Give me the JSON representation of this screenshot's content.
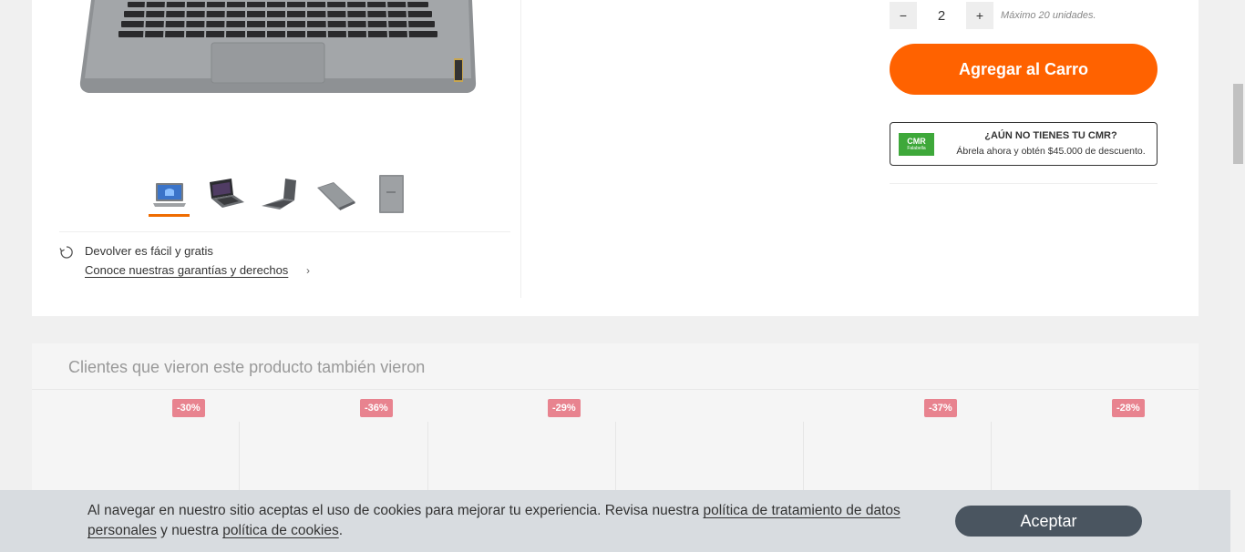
{
  "gallery": {
    "thumbnails": [
      {
        "icon": "laptop-front-icon"
      },
      {
        "icon": "laptop-angle-dark-icon"
      },
      {
        "icon": "laptop-side-icon"
      },
      {
        "icon": "laptop-closed-icon"
      },
      {
        "icon": "laptop-lid-icon"
      }
    ],
    "active_index": 0,
    "returns_title": "Devolver es fácil y gratis",
    "returns_link": "Conoce nuestras garantías y derechos"
  },
  "buy_box": {
    "minus_label": "−",
    "quantity": "2",
    "plus_label": "+",
    "max_note": "Máximo 20 unidades.",
    "add_to_cart": "Agregar al Carro",
    "cmr_logo": "CMR",
    "cmr_logo_sub": "Falabella",
    "cmr_title": "¿AÚN NO TIENES TU CMR?",
    "cmr_desc": "Ábrela ahora y obtén $45.000 de descuento."
  },
  "recommendations": {
    "title": "Clientes que vieron este producto también vieron",
    "items": [
      {
        "badge": "-30%"
      },
      {
        "badge": "-36%"
      },
      {
        "badge": "-29%"
      },
      {
        "badge": ""
      },
      {
        "badge": "-37%"
      },
      {
        "badge": "-28%"
      }
    ]
  },
  "cookie_banner": {
    "text_1": "Al navegar en nuestro sitio aceptas el uso de cookies para mejorar tu experiencia. Revisa nuestra ",
    "link_1": "política de tratamiento de datos personales",
    "text_2": " y nuestra ",
    "link_2": "política de cookies",
    "text_3": ".",
    "accept_label": "Aceptar"
  },
  "colors": {
    "accent": "#ff6200",
    "discount_badge": "#e8838f",
    "cmr_green": "#3ea83a",
    "accept_button": "#4a5560"
  }
}
